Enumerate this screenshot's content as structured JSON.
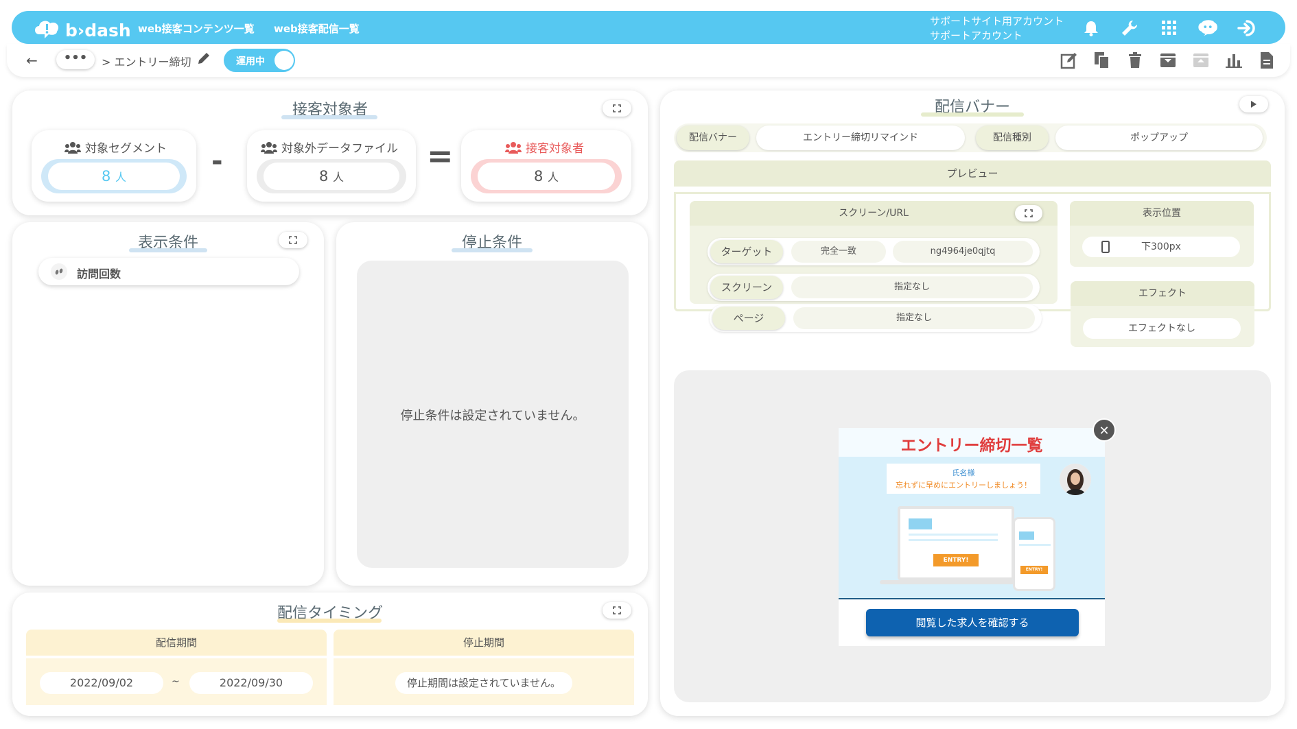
{
  "header": {
    "logo_text": "b›dash",
    "nav": [
      "web接客コンテンツ一覧",
      "web接客配信一覧"
    ],
    "account_line1": "サポートサイト用アカウント",
    "account_line2": "サポートアカウント",
    "icons": [
      "bell-icon",
      "wrench-icon",
      "grid-icon",
      "chat-robot-icon",
      "logout-icon"
    ]
  },
  "subbar": {
    "back_icon": "←",
    "more": "•••",
    "breadcrumb": "> エントリー締切",
    "toggle_label": "運用中",
    "toolbar_icons": [
      "edit-icon",
      "copy-icon",
      "trash-icon",
      "archive-icon",
      "unarchive-icon",
      "chart-icon",
      "document-icon"
    ]
  },
  "audience": {
    "title": "接客対象者",
    "target_segment": {
      "label": "対象セグメント",
      "count": "8",
      "unit": "人"
    },
    "excluded_file": {
      "label": "対象外データファイル",
      "count": "8",
      "unit": "人"
    },
    "result": {
      "label": "接客対象者",
      "count": "8",
      "unit": "人"
    },
    "minus": "-",
    "equals": "="
  },
  "display_conditions": {
    "title": "表示条件",
    "items": [
      "訪問回数"
    ]
  },
  "stop_conditions": {
    "title": "停止条件",
    "empty_message": "停止条件は設定されていません。"
  },
  "timing": {
    "title": "配信タイミング",
    "period_header": "配信期間",
    "stop_header": "停止期間",
    "start_date": "2022/09/02",
    "tilde": "~",
    "end_date": "2022/09/30",
    "stop_message": "停止期間は設定されていません。"
  },
  "banner": {
    "title": "配信バナー",
    "banner_label": "配信バナー",
    "banner_value": "エントリー締切リマインド",
    "type_label": "配信種別",
    "type_value": "ポップアップ",
    "preview_label": "プレビュー",
    "screen_url_label": "スクリーン/URL",
    "rows": [
      {
        "label": "ターゲット",
        "match": "完全一致",
        "value": "ng4964je0qjtq"
      },
      {
        "label": "スクリーン",
        "value": "指定なし"
      },
      {
        "label": "ページ",
        "value": "指定なし"
      }
    ],
    "position_label": "表示位置",
    "position_value": "下300px",
    "effect_label": "エフェクト",
    "effect_value": "エフェクトなし"
  },
  "popup": {
    "title": "エントリー締切一覧",
    "name": "氏名様",
    "message": "忘れずに早めにエントリーしましょう！",
    "entry_button": "ENTRY!",
    "entry_small": "ENTRY!",
    "cta": "閲覧した求人を確認する",
    "close": "✕"
  },
  "colors": {
    "accent": "#56c8f1",
    "blue_pill": "#cfe8f8",
    "red_pill": "#fbd3d3",
    "red_text": "#e85a5a",
    "timing_bg": "#fdf2d2",
    "olive_bg": "#eef1dc",
    "cta": "#0e62b0",
    "popup_title": "#e03c3c"
  }
}
